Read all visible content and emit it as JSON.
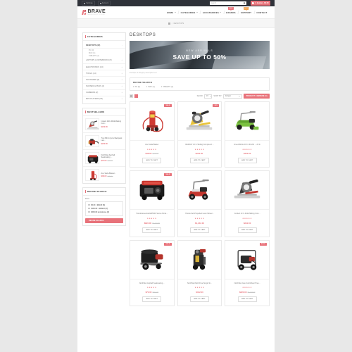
{
  "topbar": {
    "links": [
      {
        "label": "Settings",
        "icon": "gear-icon"
      },
      {
        "label": "Account",
        "icon": "user-icon"
      }
    ],
    "search_placeholder": "Search",
    "search_icon": "search-icon",
    "cart_icon": "cart-icon",
    "cart_label": "0 item(s) - $0.00"
  },
  "header": {
    "logo_name": "BRAVE",
    "logo_tagline": "MACHINERY STORE",
    "nav": [
      {
        "label": "HOME",
        "caret": true,
        "badge": null
      },
      {
        "label": "CATEGORIES",
        "caret": true,
        "badge": null
      },
      {
        "label": "ACCESSORIES",
        "caret": true,
        "badge": null
      },
      {
        "label": "BRANDS",
        "caret": false,
        "badge": "NEW",
        "badge_color": "#e8727a"
      },
      {
        "label": "SUPPORT",
        "caret": false,
        "badge": "HOT",
        "badge_color": "#efa14e"
      },
      {
        "label": "CONTACT",
        "caret": false,
        "badge": null
      }
    ]
  },
  "breadcrumb": {
    "home_icon": "home-icon",
    "separator": "/",
    "current": "DESKTOPS"
  },
  "sidebar": {
    "categories": {
      "title": "CATEGORIES",
      "items": [
        {
          "label": "DESKTOPS (32)",
          "active": true,
          "toggle": "-"
        },
        {
          "label": "PC (0)",
          "sub": true
        },
        {
          "label": "MAC (1)",
          "sub": true
        },
        {
          "label": "TABLETS (1)",
          "sub": true
        },
        {
          "label": "LAPTOPS & NOTEBOOKS (5)",
          "toggle": "+"
        },
        {
          "label": "ELECTRONICS (24)",
          "toggle": "+"
        },
        {
          "label": "TOOLS (14)",
          "toggle": "+"
        },
        {
          "label": "SOFTWARE (0)",
          "toggle": "+"
        },
        {
          "label": "PHONES & PDAS (4)",
          "toggle": "+"
        },
        {
          "label": "CAMERAS (2)",
          "toggle": "+"
        },
        {
          "label": "MP3 PLAYERS (19)",
          "toggle": "+"
        }
      ]
    },
    "bestsellers": {
      "title": "BESTSELLERS",
      "items": [
        {
          "name": "Instant 240v Multi-Making Com...",
          "price": "$242.00",
          "old": "",
          "art": "saw"
        },
        {
          "name": "Troy-Bilt 4-Cycle Backpack Lea...",
          "price": "$222.00",
          "old": "",
          "art": "blower"
        },
        {
          "name": "NorthStar Asphalt Sealcoating ...",
          "price": "$70.00",
          "old": "$110.00",
          "art": "generator"
        },
        {
          "name": "Ace Soda Blaster...",
          "price": "$38.00",
          "old": "$122.00",
          "art": "sandblaster"
        }
      ]
    },
    "refine": {
      "title": "REFINE SEARCH",
      "field_label": "Price",
      "options": [
        {
          "label": "$0.00 - $99.00 (8)",
          "checked": false
        },
        {
          "label": "$100.00 - $199.00 (7)",
          "checked": false
        },
        {
          "label": "$200.00 and above (6)",
          "checked": false
        }
      ],
      "button": "REFINE SEARCH"
    }
  },
  "content": {
    "page_title": "DESKTOPS",
    "banner": {
      "small": "NEW ARRIVALS",
      "large": "SAVE UP TO 50%"
    },
    "category_description": "Example of category description text",
    "refine_panel": {
      "title": "REFINE SEARCH",
      "links": [
        {
          "label": "PC (0)"
        },
        {
          "label": "MAC (1)"
        },
        {
          "label": "TABLETS (1)"
        }
      ]
    },
    "toolbar": {
      "view_grid_icon": "grid-view-icon",
      "view_list_icon": "list-view-icon",
      "show_label": "SHOW:",
      "show_value": "15",
      "sort_label": "SORT BY:",
      "sort_value": "Default",
      "compare_button": "PRODUCT COMPARE (0)"
    },
    "products": [
      {
        "name": "Ace Soda Blaster",
        "price": "$38.00",
        "old": "$122.00",
        "stars": "★★★★★",
        "badge": "SALE",
        "cart": "ADD TO CART",
        "art": "sandblaster"
      },
      {
        "name": "DEWALT 12 In Sliding Compound ...",
        "price": "$242.00",
        "old": "",
        "stars": "★★★★★",
        "badge": "-10%",
        "cart": "ADD TO CART",
        "art": "mitersaw-yellow"
      },
      {
        "name": "GreenWorks 16 In 40-Volt ... 20 In",
        "price": "$422.00",
        "old": "",
        "stars": "★★★★★",
        "badge": null,
        "cart": "ADD TO CART",
        "art": "mower-green"
      },
      {
        "name": "Honda Essential EM5000 Series Porta...",
        "price": "$822.00",
        "old": "$1,122.00",
        "stars": "★★★★★",
        "badge": "SALE",
        "cart": "ADD TO CART",
        "art": "generator"
      },
      {
        "name": "Honda Self-Propelled Lawn Mower...",
        "price": "$1,242.00",
        "old": "",
        "stars": "★★★★★",
        "badge": null,
        "cart": "ADD TO CART",
        "art": "mower-red"
      },
      {
        "name": "Corded 10 In Multi-Sliding Com...",
        "price": "$242.00",
        "old": "",
        "stars": "★★★★★",
        "badge": null,
        "cart": "ADD TO CART",
        "art": "mitersaw-gray"
      },
      {
        "name": "NorthStar Asphalt Sealcoating ...",
        "price": "$70.00",
        "old": "$110.00",
        "stars": "★★★★★",
        "badge": "SALE",
        "cart": "ADD TO CART",
        "art": "sealcoater"
      },
      {
        "name": "NorthStar Belt Drive Single St...",
        "price": "$442.00",
        "old": "",
        "stars": "★★★★★",
        "badge": null,
        "cart": "ADD TO CART",
        "art": "compressor"
      },
      {
        "name": "NorthStar Gas Cold Water Pres...",
        "price": "$820.00",
        "old": "$1,122.00",
        "stars": "★★★★★",
        "badge": "SALE",
        "cart": "ADD TO CART",
        "art": "washer"
      }
    ]
  },
  "colors": {
    "accent": "#e8727a",
    "topbar_bg": "#2f3239",
    "page_bg": "#e8e8e8",
    "badge_hot": "#efa14e"
  }
}
